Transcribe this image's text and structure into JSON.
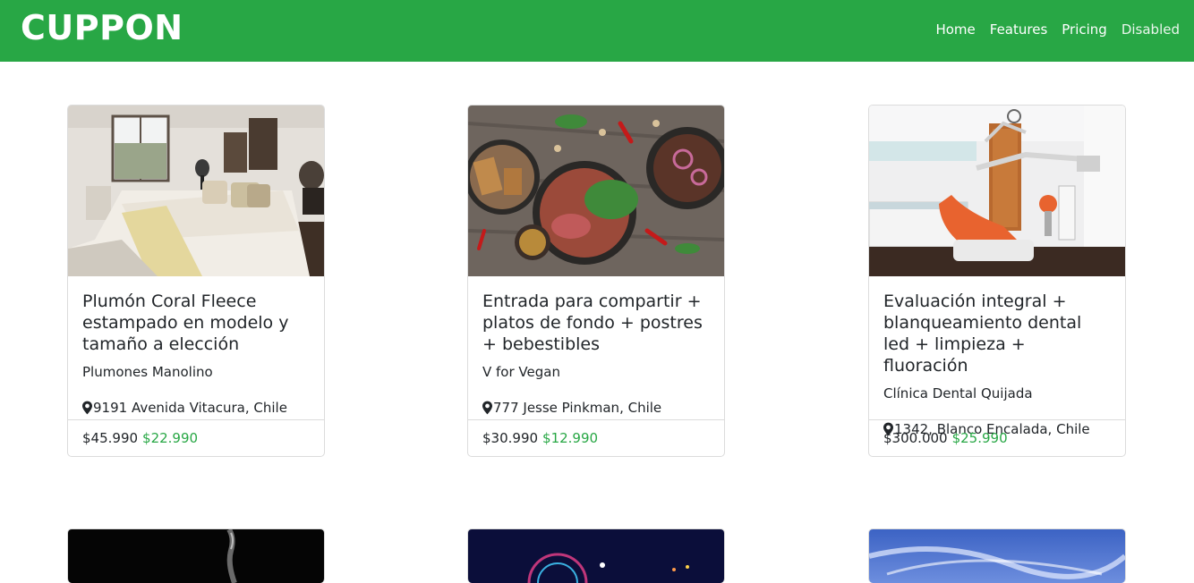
{
  "navbar": {
    "brand": "CUPPON",
    "links": [
      {
        "label": "Home"
      },
      {
        "label": "Features"
      },
      {
        "label": "Pricing"
      },
      {
        "label": "Disabled"
      }
    ]
  },
  "cards": [
    {
      "title": "Plumón Coral Fleece estampado en modelo y tamaño a elección",
      "merchant": "Plumones Manolino",
      "location": "9191 Avenida Vitacura, Chile",
      "old_price": "$45.990",
      "new_price": "$22.990",
      "image": "bedroom"
    },
    {
      "title": "Entrada para compartir + platos de fondo + postres + bebestibles",
      "merchant": "V for Vegan",
      "location": "777 Jesse Pinkman, Chile",
      "old_price": "$30.990",
      "new_price": "$12.990",
      "image": "food-plates"
    },
    {
      "title": "Evaluación integral + blanqueamiento dental led + limpieza + fluoración",
      "merchant": "Clínica Dental Quijada",
      "location": "1342, Blanco Encalada, Chile",
      "old_price": "$300.000",
      "new_price": "$25.990",
      "image": "dental-office"
    }
  ],
  "colors": {
    "brand": "#28a745",
    "price_new": "#28a745"
  }
}
